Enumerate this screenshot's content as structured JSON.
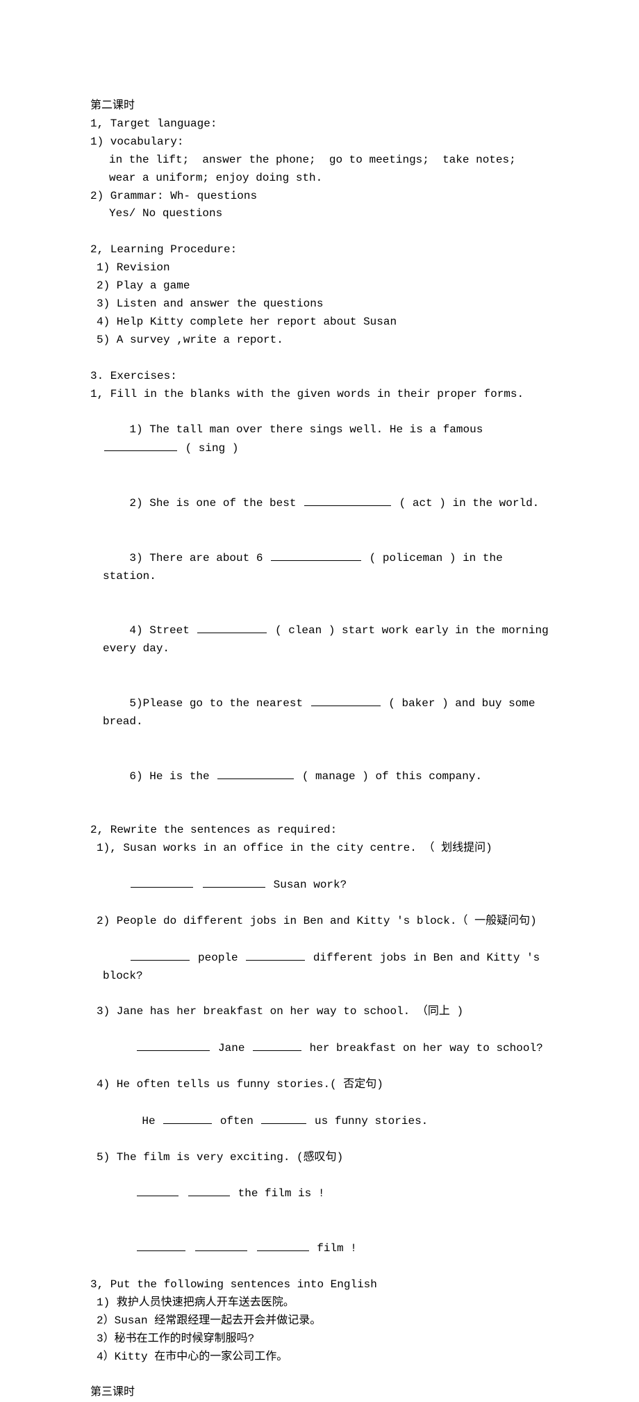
{
  "lesson2_title": "第二课时",
  "section1": {
    "heading": "1, Target language:",
    "vocab_label": "1) vocabulary:",
    "vocab_line1": "in the lift;  answer the phone;  go to meetings;  take notes;",
    "vocab_line2": "wear a uniform; enjoy doing sth.",
    "grammar_label": "2) Grammar: Wh- questions",
    "grammar_line2": "Yes/ No questions"
  },
  "section2": {
    "heading": "2, Learning Procedure:",
    "i1": "1) Revision",
    "i2": "2) Play a game",
    "i3": "3) Listen and answer the questions",
    "i4": "4) Help Kitty complete her report about Susan",
    "i5": "5) A survey ,write a report."
  },
  "section3": {
    "heading": "3. Exercises:",
    "part1_heading": "1, Fill in the blanks with the given words in their proper forms.",
    "q1a": "1) The tall man over there sings well. He is a famous ",
    "q1b": " ( sing )",
    "q2a": "2) She is one of the best ",
    "q2b": " ( act ) in the world.",
    "q3a": "3) There are about 6 ",
    "q3b": " ( policeman ) in the station.",
    "q4a": "4) Street ",
    "q4b": " ( clean ) start work early in the morning every day.",
    "q5a": "5)Please go to the nearest ",
    "q5b": " ( baker ) and buy some bread.",
    "q6a": "6) He is the ",
    "q6b": " ( manage ) of this company.",
    "part2_heading": "2, Rewrite the sentences as required:",
    "r1": "1), Susan works in an office in the city centre. （ 划线提问)",
    "r1b": " Susan work?",
    "r2": "2) People do different jobs in Ben and Kitty 's block.（ 一般疑问句)",
    "r2a": " people ",
    "r2b": " different jobs in Ben and Kitty 's block?",
    "r3": "3) Jane has her breakfast on her way to school. （同上 )",
    "r3a": " Jane ",
    "r3b": " her breakfast on her way to school?",
    "r4": "4) He often tells us funny stories.( 否定句)",
    "r4a": "He ",
    "r4b": " often ",
    "r4c": " us funny stories.",
    "r5": "5) The film is very exciting. (感叹句)",
    "r5a": " the film is !",
    "r5b": " film !",
    "part3_heading": "3, Put the following sentences into English",
    "t1": "1) 救护人员快速把病人开车送去医院。",
    "t2": "2）Susan 经常跟经理一起去开会并做记录。",
    "t3": "3）秘书在工作的时候穿制服吗?",
    "t4": "4）Kitty 在市中心的一家公司工作。"
  },
  "lesson3_title": "第三课时"
}
